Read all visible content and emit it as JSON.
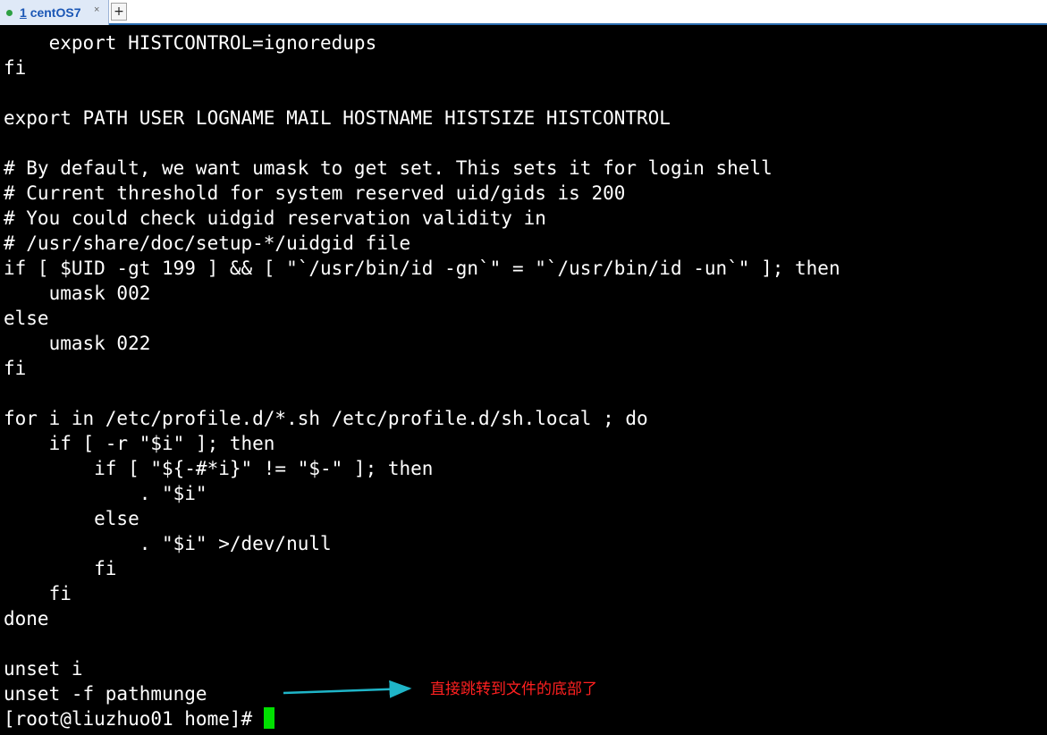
{
  "tab": {
    "number": "1",
    "title": "centOS7",
    "close": "×",
    "new_tab": "+"
  },
  "terminal": {
    "lines": [
      "    export HISTCONTROL=ignoredups",
      "fi",
      "",
      "export PATH USER LOGNAME MAIL HOSTNAME HISTSIZE HISTCONTROL",
      "",
      "# By default, we want umask to get set. This sets it for login shell",
      "# Current threshold for system reserved uid/gids is 200",
      "# You could check uidgid reservation validity in",
      "# /usr/share/doc/setup-*/uidgid file",
      "if [ $UID -gt 199 ] && [ \"`/usr/bin/id -gn`\" = \"`/usr/bin/id -un`\" ]; then",
      "    umask 002",
      "else",
      "    umask 022",
      "fi",
      "",
      "for i in /etc/profile.d/*.sh /etc/profile.d/sh.local ; do",
      "    if [ -r \"$i\" ]; then",
      "        if [ \"${-#*i}\" != \"$-\" ]; then",
      "            . \"$i\"",
      "        else",
      "            . \"$i\" >/dev/null",
      "        fi",
      "    fi",
      "done",
      "",
      "unset i",
      "unset -f pathmunge"
    ],
    "prompt": "[root@liuzhuo01 home]# "
  },
  "annotation": {
    "text": "直接跳转到文件的底部了",
    "color": "#ff2020",
    "arrow_color": "#1fb5c8"
  },
  "colors": {
    "background": "#000000",
    "foreground": "#ffffff",
    "cursor": "#00e000",
    "tab_accent": "#1a56b5"
  }
}
